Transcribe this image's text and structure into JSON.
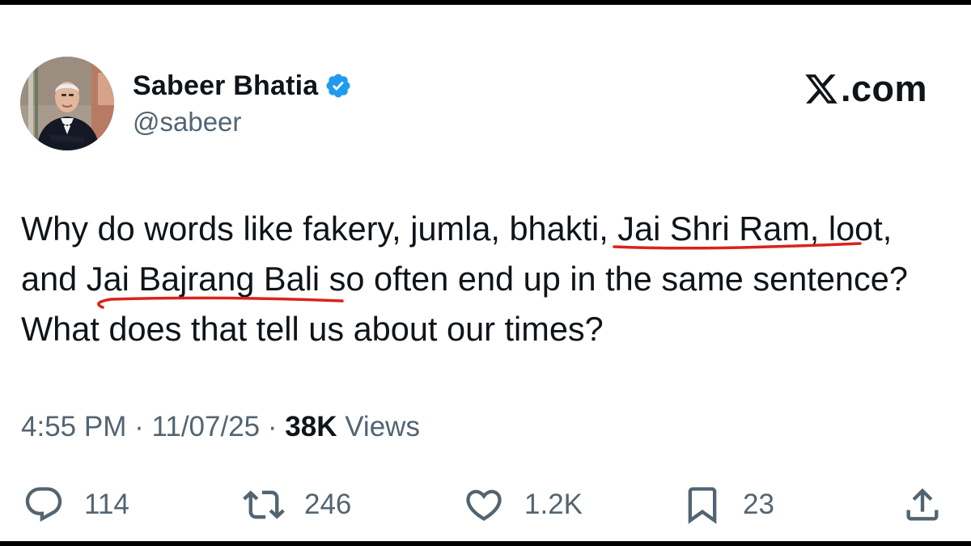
{
  "author": {
    "name": "Sabeer Bhatia",
    "handle": "@sabeer",
    "verified": true,
    "avatar": "profile-photo"
  },
  "brand": {
    "text": ".com",
    "icon": "x-logo-icon"
  },
  "tweet": {
    "text_parts": [
      "Why do words like fakery, jumla, bhakti, ",
      "Jai Shri Ram,",
      " loot, and ",
      "Jai Bajrang Bali",
      " so often end up in the same sentence? What does that tell us about our times?"
    ],
    "underline_color": "#d9231c"
  },
  "meta": {
    "time": "4:55 PM",
    "separator": "·",
    "date": "11/07/25",
    "views_count": "38K",
    "views_label": "Views"
  },
  "actions": {
    "replies": {
      "icon": "reply-icon",
      "count": "114"
    },
    "reposts": {
      "icon": "repost-icon",
      "count": "246"
    },
    "likes": {
      "icon": "heart-icon",
      "count": "1.2K"
    },
    "bookmarks": {
      "icon": "bookmark-icon",
      "count": "23"
    },
    "share": {
      "icon": "share-icon"
    }
  },
  "colors": {
    "text": "#0f1419",
    "secondary": "#536471",
    "verified_blue": "#1d9bf0",
    "background": "#ffffff"
  }
}
